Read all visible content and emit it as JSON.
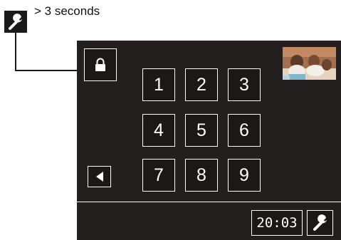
{
  "callout": {
    "icon": "wrench-icon",
    "caption": "> 3 seconds"
  },
  "panel": {
    "lock_button": {
      "icon": "lock-icon"
    },
    "back_button": {
      "icon": "back-arrow-icon"
    },
    "thumbnail": {
      "description_icon": "family-photo-thumbnail"
    },
    "keypad": {
      "keys": [
        "1",
        "2",
        "3",
        "4",
        "5",
        "6",
        "7",
        "8",
        "9"
      ]
    },
    "status_bar": {
      "time": "20:03",
      "settings_button": {
        "icon": "wrench-icon"
      }
    }
  }
}
